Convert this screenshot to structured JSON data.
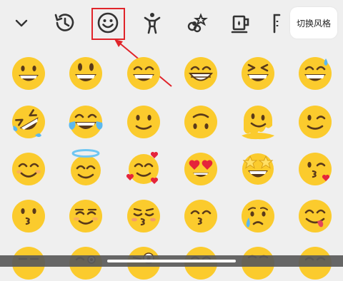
{
  "toolbar": {
    "collapse_icon": "chevron-down-icon",
    "tabs": [
      {
        "name": "recent",
        "icon": "history-clock-icon"
      },
      {
        "name": "smileys",
        "icon": "smiley-face-icon",
        "selected": true
      },
      {
        "name": "people-activity",
        "icon": "person-activity-icon"
      },
      {
        "name": "animals-nature",
        "icon": "nature-icon"
      },
      {
        "name": "food-drink",
        "icon": "cup-icon"
      },
      {
        "name": "more",
        "icon": "object-icon"
      }
    ],
    "style_switch_label": "切换风格"
  },
  "annotation": {
    "highlight_color": "#e0242a"
  },
  "emoji_grid": {
    "rows": [
      [
        "grinning-face",
        "grinning-big-eyes",
        "grinning-smiling-eyes",
        "beaming-face",
        "grinning-squinting-face",
        "grinning-sweat"
      ],
      [
        "rolling-laughing",
        "tears-of-joy",
        "slightly-smiling",
        "upside-down-face",
        "melting-face",
        "winking-face"
      ],
      [
        "smiling-eyes",
        "halo-face",
        "smiling-hearts",
        "heart-eyes",
        "star-struck",
        "face-blowing-kiss"
      ],
      [
        "kissing-face",
        "smiling-face",
        "kissing-closed-eyes",
        "kissing-smiling-eyes",
        "crying-face",
        "face-savoring-food"
      ],
      [
        "partial-face-1",
        "partial-face-2",
        "partial-face-3",
        "partial-face-4",
        "partial-face-5",
        "partial-face-6"
      ]
    ]
  },
  "colors": {
    "background": "#efefef",
    "emoji_yellow": "#fbcb2d",
    "emoji_dark": "#5a3a1a",
    "style_button_bg": "#ffffff"
  }
}
